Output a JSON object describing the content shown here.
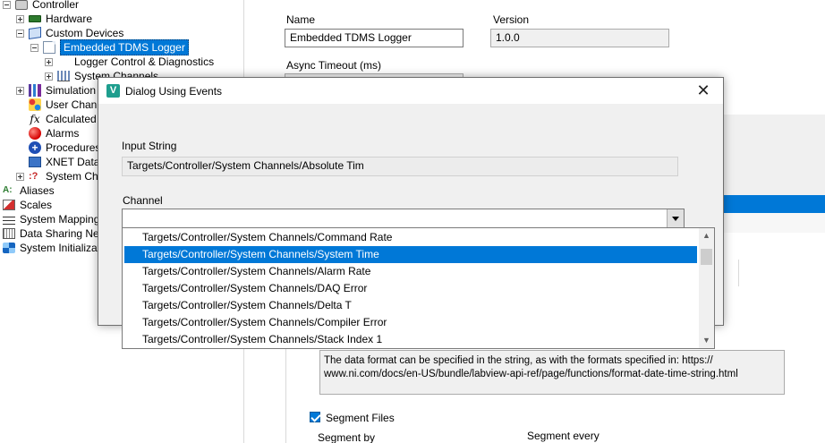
{
  "tree": {
    "items": [
      {
        "label": "Controller",
        "icon": "controller-icon",
        "expander": "minus"
      },
      {
        "label": "Hardware",
        "icon": "hardware-chip-icon",
        "expander": "plus"
      },
      {
        "label": "Custom Devices",
        "icon": "cube-icon",
        "expander": "minus"
      },
      {
        "label": "Embedded TDMS Logger",
        "icon": "page-icon",
        "expander": "minus",
        "selected": true
      },
      {
        "label": "Logger Control & Diagnostics",
        "expander": "plus"
      },
      {
        "label": "System Channels",
        "icon": "bar-chart-icon",
        "expander": "plus"
      },
      {
        "label": "Simulation",
        "icon": "simulation-bars-icon",
        "expander": "plus"
      },
      {
        "label": "User Channels",
        "icon": "user-channels-icon"
      },
      {
        "label": "Calculated",
        "icon": "fx-icon"
      },
      {
        "label": "Alarms",
        "icon": "alarm-icon"
      },
      {
        "label": "Procedures",
        "icon": "procedure-icon"
      },
      {
        "label": "XNET Database",
        "icon": "xnet-icon"
      },
      {
        "label": "System Channels",
        "icon": "system-channels-icon",
        "expander": "plus"
      },
      {
        "label": "Aliases",
        "icon": "alias-icon"
      },
      {
        "label": "Scales",
        "icon": "scale-icon"
      },
      {
        "label": "System Mappings",
        "icon": "mapping-icon"
      },
      {
        "label": "Data Sharing Network",
        "icon": "share-icon"
      },
      {
        "label": "System Initialization",
        "icon": "init-icon"
      }
    ]
  },
  "props": {
    "name_label": "Name",
    "name_value": "Embedded TDMS Logger",
    "version_label": "Version",
    "version_value": "1.0.0",
    "async_label": "Async Timeout (ms)",
    "info_text": "The data format can be specified in the string, as with the formats specified in: https://\nwww.ni.com/docs/en-US/bundle/labview-api-ref/page/functions/format-date-time-string.html",
    "segment_files_label": "Segment Files",
    "segment_files_checked": true,
    "segment_by_label": "Segment by",
    "segment_every_label": "Segment every"
  },
  "dialog": {
    "title": "Dialog Using Events",
    "close_icon": "close-icon",
    "input_string_label": "Input String",
    "input_string_value": "Targets/Controller/System Channels/Absolute Tim",
    "channel_label": "Channel",
    "channel_value": "",
    "options": [
      "Targets/Controller/System Channels/Command Rate",
      "Targets/Controller/System Channels/System Time",
      "Targets/Controller/System Channels/Alarm Rate",
      "Targets/Controller/System Channels/DAQ Error",
      "Targets/Controller/System Channels/Delta T",
      "Targets/Controller/System Channels/Compiler Error",
      "Targets/Controller/System Channels/Stack Index 1"
    ],
    "selected_option": "Targets/Controller/System Channels/System Time"
  },
  "colors": {
    "accent": "#0078d7",
    "dialog_bg": "#f0f0f0",
    "logo": "#1e9e8e"
  }
}
